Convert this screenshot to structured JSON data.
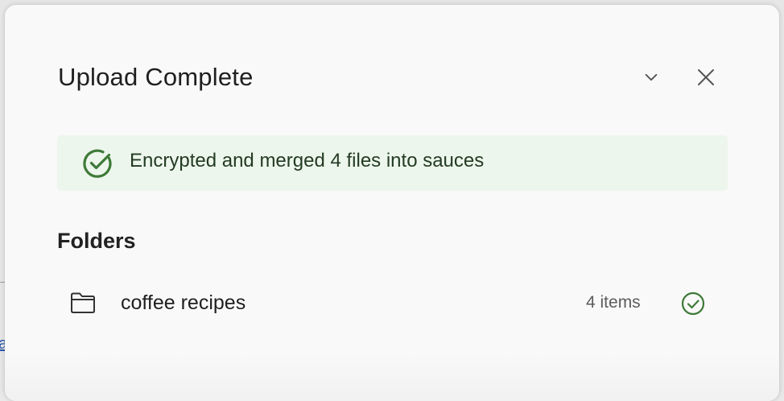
{
  "dialog": {
    "title": "Upload Complete",
    "collapse_icon": "chevron-down-icon",
    "close_icon": "close-icon"
  },
  "banner": {
    "icon": "check-circle-icon",
    "message": "Encrypted and merged 4 files into sauces",
    "background": "#edf6ec",
    "accent": "#3e7a38"
  },
  "folders": {
    "heading": "Folders",
    "items": [
      {
        "name": "coffee recipes",
        "count": "4 items",
        "icon": "folder-icon",
        "status_icon": "check-circle-icon"
      }
    ]
  },
  "backdrop": {
    "link_fragment": "a"
  }
}
